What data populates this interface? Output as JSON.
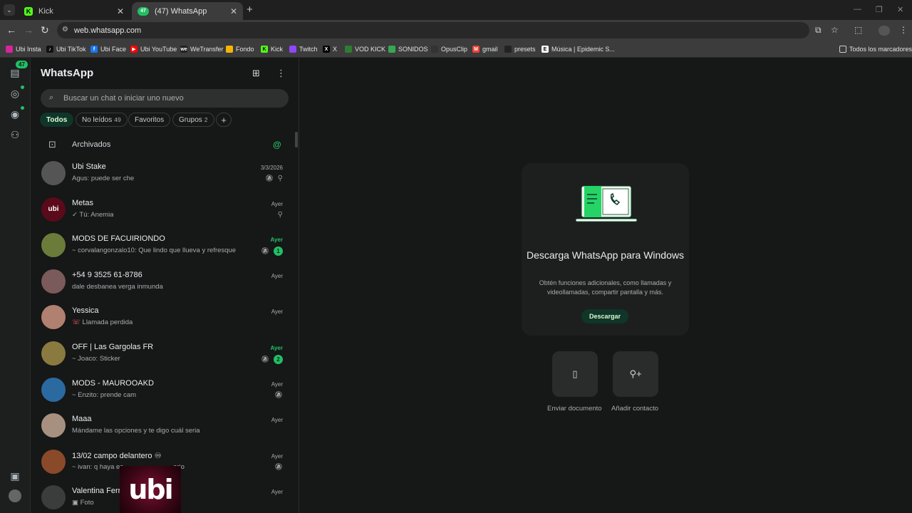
{
  "browser": {
    "tabs": [
      {
        "title": "Kick",
        "favicon": "kick-icon",
        "active": false
      },
      {
        "title": "(47) WhatsApp",
        "favicon": "whatsapp-icon",
        "badge": "47",
        "active": true
      }
    ],
    "url": "web.whatsapp.com",
    "bookmarks": [
      {
        "label": "Ubi Insta",
        "color": "#d6249f"
      },
      {
        "label": "Ubi TikTok",
        "color": "#111111"
      },
      {
        "label": "Ubi Face",
        "color": "#1877f2"
      },
      {
        "label": "Ubi YouTube",
        "color": "#ff0000"
      },
      {
        "label": "WeTransfer",
        "color": "#222222"
      },
      {
        "label": "Fondo",
        "color": "#f7b500"
      },
      {
        "label": "Kick",
        "color": "#53fc18"
      },
      {
        "label": "Twitch",
        "color": "#9146ff"
      },
      {
        "label": "X",
        "color": "#000000"
      },
      {
        "label": "VOD KICK",
        "color": "#2e7d32"
      },
      {
        "label": "SONIDOS",
        "color": "#34a853"
      },
      {
        "label": "OpusClip",
        "color": "#333333"
      },
      {
        "label": "gmail",
        "color": "#ea4335"
      },
      {
        "label": "presets",
        "color": "#222222"
      },
      {
        "label": "Música | Epidemic S...",
        "color": "#ffffff"
      }
    ],
    "all_bookmarks": "Todos los marcadores"
  },
  "rail": {
    "chats_badge": "47"
  },
  "sidebar": {
    "title": "WhatsApp",
    "search_placeholder": "Buscar un chat o iniciar uno nuevo",
    "filters": [
      {
        "label": "Todos",
        "count": ""
      },
      {
        "label": "No leídos",
        "count": "49"
      },
      {
        "label": "Favoritos",
        "count": ""
      },
      {
        "label": "Grupos",
        "count": "2"
      }
    ],
    "archived_label": "Archivados",
    "chats": [
      {
        "name": "Ubi Stake",
        "message": "Agus: puede ser che",
        "time": "3/3/2026",
        "muted": true,
        "pinned": true,
        "unread": "",
        "avatar_color": "#555555",
        "avatar_text": ""
      },
      {
        "name": "Metas",
        "message": "✓ Tú: Anemia",
        "time": "Ayer",
        "muted": false,
        "pinned": true,
        "unread": "",
        "avatar_color": "#5a0a1a",
        "avatar_text": "ubi"
      },
      {
        "name": "MODS DE FACUIRIONDO",
        "message": "~ corvalangonzalo10: Que lindo que llueva y refresque",
        "time": "Ayer",
        "muted": true,
        "pinned": false,
        "unread": "1",
        "avatar_color": "#6b7b3a",
        "avatar_text": ""
      },
      {
        "name": "+54 9 3525 61-8786",
        "message": "dale desbanea verga inmunda",
        "time": "Ayer",
        "muted": false,
        "pinned": false,
        "unread": "",
        "avatar_color": "#7a5a5a",
        "avatar_text": ""
      },
      {
        "name": "Yessica",
        "message": "Llamada perdida",
        "time": "Ayer",
        "muted": false,
        "pinned": false,
        "unread": "",
        "avatar_color": "#b08070",
        "avatar_text": "",
        "missed_call": true
      },
      {
        "name": "OFF | Las Gargolas FR",
        "message": "~ Joaco: Sticker",
        "time": "Ayer",
        "muted": true,
        "pinned": false,
        "unread": "2",
        "avatar_color": "#8a7a40",
        "avatar_text": ""
      },
      {
        "name": "MODS - MAUROOAKD",
        "message": "~ Enzito: prende cam",
        "time": "Ayer",
        "muted": true,
        "pinned": false,
        "unread": "",
        "avatar_color": "#2a6aa0",
        "avatar_text": ""
      },
      {
        "name": "Maaa",
        "message": "Mándame las opciones y te digo cuál seria",
        "time": "Ayer",
        "muted": false,
        "pinned": false,
        "unread": "",
        "avatar_color": "#a89080",
        "avatar_text": ""
      },
      {
        "name": "13/02  campo delantero ♾",
        "message": "~ ivan: q haya es",
        "message_tail": "ario",
        "time": "Ayer",
        "muted": true,
        "pinned": false,
        "unread": "",
        "avatar_color": "#8a4a2a",
        "avatar_text": ""
      },
      {
        "name": "Valentina Ferr",
        "message": "Foto",
        "time": "Ayer",
        "muted": false,
        "pinned": false,
        "unread": "",
        "avatar_color": "#3b3d3d",
        "avatar_text": "",
        "photo": true
      }
    ]
  },
  "overlay": {
    "text": "ubi"
  },
  "main": {
    "promo_title": "Descarga WhatsApp para Windows",
    "promo_text": "Obtén funciones adicionales, como llamadas y videollamadas, compartir pantalla y más.",
    "promo_button": "Descargar",
    "actions": [
      {
        "label": "Enviar documento",
        "icon": "document-icon"
      },
      {
        "label": "Añadir contacto",
        "icon": "add-contact-icon"
      }
    ]
  }
}
